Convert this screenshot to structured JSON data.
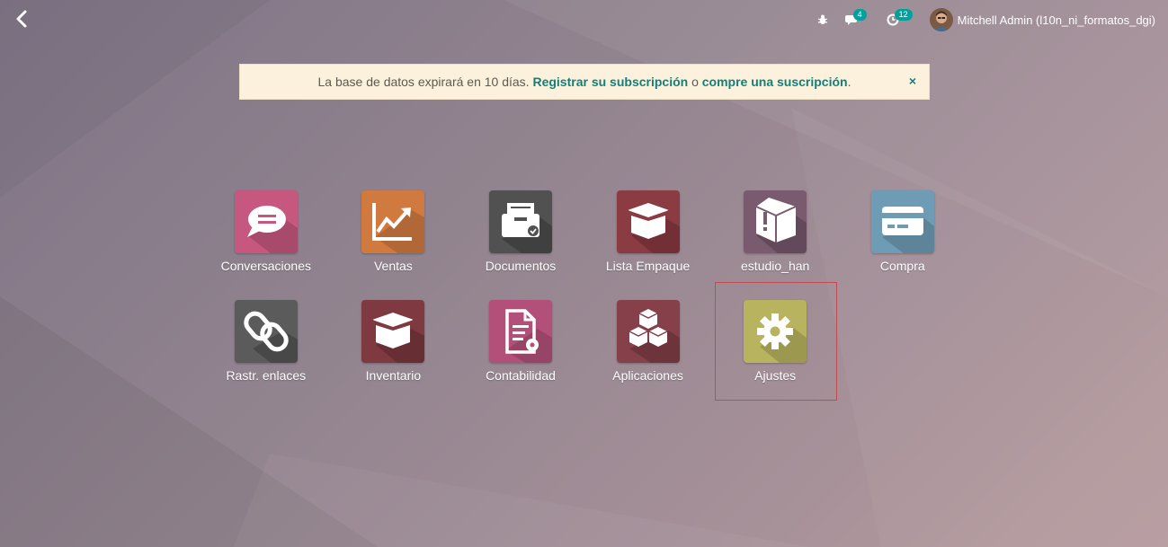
{
  "topbar": {
    "back_icon": "chevron-left-icon",
    "debug_icon": "bug-icon",
    "messages_icon": "comments-icon",
    "messages_count": "4",
    "activities_icon": "clock-icon",
    "activities_count": "12",
    "user_name": "Mitchell Admin (l10n_ni_formatos_dgi)"
  },
  "banner": {
    "text_before": "La base de datos expirará en 10 días.",
    "link_register": "Registrar su subscripción",
    "text_middle": "o",
    "link_buy": "compre una suscripción",
    "text_after": ".",
    "close": "×"
  },
  "apps": [
    {
      "label": "Conversaciones",
      "icon": "chat-bubble-icon",
      "color": "#c6577f"
    },
    {
      "label": "Ventas",
      "icon": "trend-chart-icon",
      "color": "#d17a40"
    },
    {
      "label": "Documentos",
      "icon": "inbox-tray-icon",
      "color": "#515151"
    },
    {
      "label": "Lista Empaque",
      "icon": "open-box-icon",
      "color": "#8b3b42"
    },
    {
      "label": "estudio_han",
      "icon": "warning-box-icon",
      "color": "#7a5a6e"
    },
    {
      "label": "Compra",
      "icon": "credit-card-icon",
      "color": "#6f9cb5"
    },
    {
      "label": "Rastr. enlaces",
      "icon": "link-icon",
      "color": "#5b5b5b"
    },
    {
      "label": "Inventario",
      "icon": "open-box-icon",
      "color": "#7e3a40"
    },
    {
      "label": "Contabilidad",
      "icon": "document-gear-icon",
      "color": "#b3507a"
    },
    {
      "label": "Aplicaciones",
      "icon": "cubes-icon",
      "color": "#86404a"
    },
    {
      "label": "Ajustes",
      "icon": "gear-icon",
      "color": "#b8b35e"
    }
  ],
  "selected_app": "Ajustes"
}
